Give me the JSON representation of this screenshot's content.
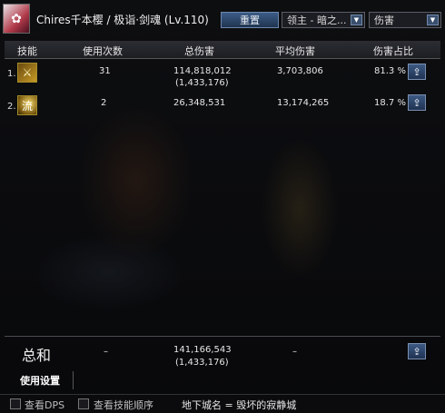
{
  "header": {
    "title": "Chires千本樱 / 极诣·剑魂 (Lv.110)",
    "reset_button": "重置",
    "target_select": "领主 - 暗之...",
    "metric_select": "伤害"
  },
  "table": {
    "columns": [
      "技能",
      "使用次数",
      "总伤害",
      "平均伤害",
      "伤害占比"
    ],
    "rows": [
      {
        "index": "1.",
        "icon": "crossed-swords-skill-icon",
        "icon_glyph": "⚔",
        "uses": "31",
        "total": "114,818,012",
        "total_sub": "(1,433,176)",
        "avg": "3,703,806",
        "share": "81.3 %"
      },
      {
        "index": "2.",
        "icon": "flow-skill-icon",
        "icon_glyph": "流",
        "uses": "2",
        "total": "26,348,531",
        "total_sub": "",
        "avg": "13,174,265",
        "share": "18.7 %"
      }
    ]
  },
  "summary": {
    "label": "总和",
    "uses": "–",
    "total": "141,166,543",
    "total_sub": "(1,433,176)",
    "avg": "–"
  },
  "settings_tab": "使用设置",
  "footer": {
    "view_dps": "查看DPS",
    "view_skill_order": "查看技能顺序",
    "dungeon": "地下城名 = 毁坏的寂静城"
  },
  "colors": {
    "accent": "#3d5a84",
    "header_bg": "#2c2d33"
  }
}
